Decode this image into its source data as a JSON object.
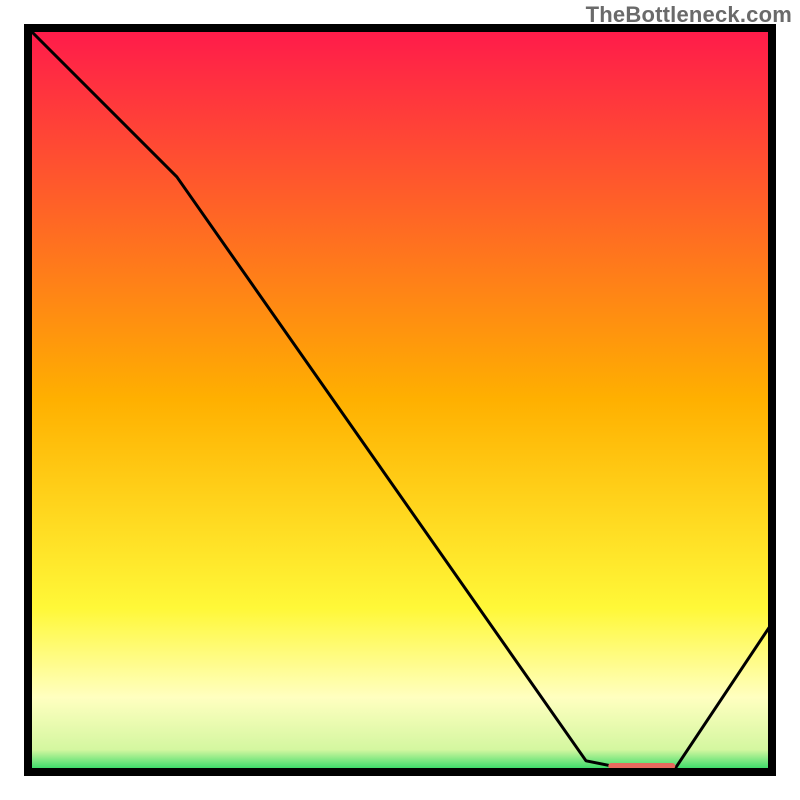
{
  "attribution": "TheBottleneck.com",
  "chart_data": {
    "type": "line",
    "title": "",
    "xlabel": "",
    "ylabel": "",
    "xlim": [
      0,
      100
    ],
    "ylim": [
      0,
      100
    ],
    "series": [
      {
        "name": "curve",
        "x": [
          0,
          20,
          75,
          80,
          87,
          100
        ],
        "y": [
          100,
          80,
          1.5,
          0.5,
          0.5,
          20
        ]
      }
    ],
    "marker_band": {
      "x0": 78,
      "x1": 87,
      "y": 0.8
    },
    "gradient_stops": [
      {
        "offset": 0.0,
        "color": "#ff1a4b"
      },
      {
        "offset": 0.5,
        "color": "#ffb000"
      },
      {
        "offset": 0.78,
        "color": "#fff838"
      },
      {
        "offset": 0.9,
        "color": "#ffffc0"
      },
      {
        "offset": 0.97,
        "color": "#d4f7a0"
      },
      {
        "offset": 1.0,
        "color": "#1fd65f"
      }
    ]
  }
}
